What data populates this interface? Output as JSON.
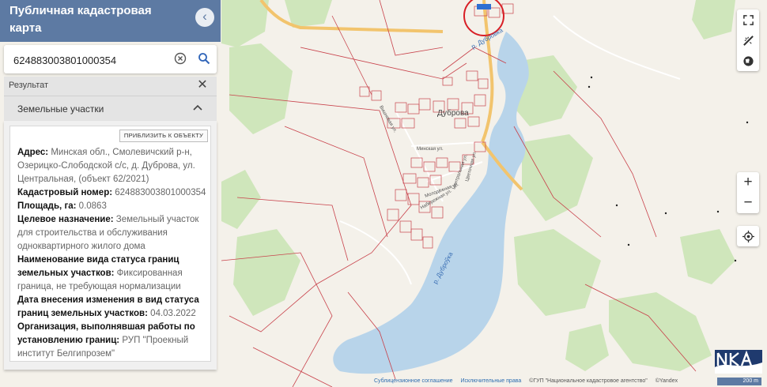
{
  "header": {
    "title": "Публичная кадастровая карта"
  },
  "search": {
    "value": "624883003801000354"
  },
  "results": {
    "label": "Результат",
    "section_label": "Земельные участки",
    "zoom_button": "ПРИБЛИЗИТЬ К ОБЪЕКТУ"
  },
  "parcel": {
    "address_key": "Адрес:",
    "address_val": "Минская обл., Смолевичский р-н, Озерицко-Слободской с/с, д. Дуброва, ул. Центральная, (объект 62/2021)",
    "cadastral_key": "Кадастровый номер:",
    "cadastral_val": "624883003801000354",
    "area_key": "Площадь, га:",
    "area_val": "0.0863",
    "purpose_key": "Целевое назначение:",
    "purpose_val": "Земельный участок для строительства и обслуживания одноквартирного жилого дома",
    "boundary_key": "Наименование вида статуса границ земельных участков:",
    "boundary_val": "Фиксированная граница, не требующая нормализации",
    "date_key": "Дата внесения изменения в вид статуса границ земельных участков:",
    "date_val": "04.03.2022",
    "org_key": "Организация, выполнявшая работы по установлению границ:",
    "org_val": "РУП \"Проекный институт Белгипрозем\""
  },
  "map": {
    "village_label": "Дуброва",
    "river_label_1": "р. Дубровка",
    "river_label_2": "р. Дуброўка",
    "street_1": "Минская ул.",
    "street_2": "Центральная ул.",
    "street_3": "Молодёжная ул.",
    "street_4": "Вишневая ул.",
    "street_5": "Набережная ул.",
    "street_6": "Цветочная ул."
  },
  "attribution": {
    "link_1": "Сублицензионное соглашение",
    "link_2": "Исключительные права",
    "owner": "©ГУП \"Национальное кадастровое агентство\"",
    "yandex": "©Yandex"
  },
  "scale_label": "200 m",
  "colors": {
    "header": "#5d7aa3",
    "parcel_line": "#c8424b",
    "water": "#b8d4ea",
    "forest": "#cfe6bb",
    "road": "#f2c46d"
  },
  "icons": [
    "chevron-left-icon",
    "clear-icon",
    "search-icon",
    "close-icon",
    "chevron-up-icon",
    "fullscreen-icon",
    "ruler-icon",
    "globe-icon",
    "plus-icon",
    "minus-icon",
    "locate-icon",
    "nka-logo"
  ]
}
